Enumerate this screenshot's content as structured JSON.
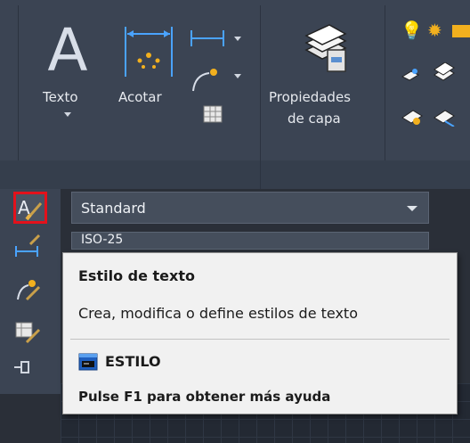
{
  "ribbon": {
    "texto_label": "Texto",
    "acotar_label": "Acotar",
    "propiedades_line1": "Propiedades",
    "propiedades_line2": "de capa"
  },
  "combos": {
    "text_style_value": "Standard",
    "dim_style_value": "ISO-25"
  },
  "tooltip": {
    "title": "Estilo de texto",
    "description": "Crea, modifica o define estilos de texto",
    "command": "ESTILO",
    "help": "Pulse F1 para obtener más ayuda"
  },
  "colors": {
    "highlight": "#e3111b",
    "ribbon_bg": "#3b4453",
    "tooltip_bg": "#f1f1f1"
  }
}
